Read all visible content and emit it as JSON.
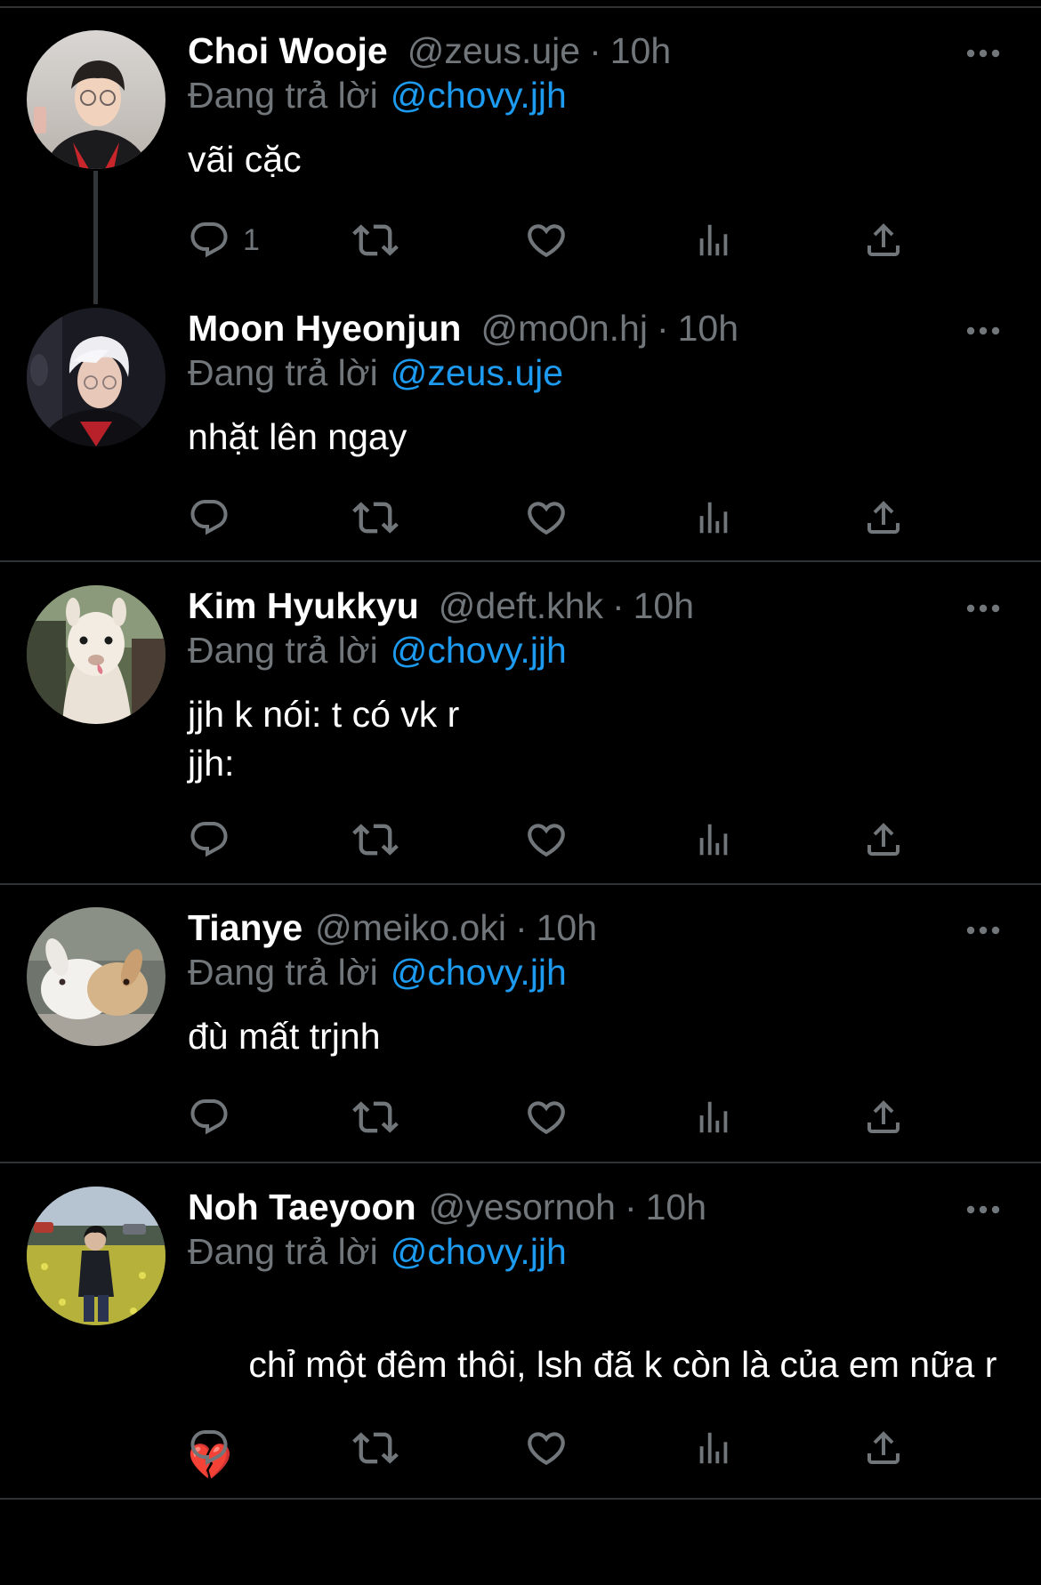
{
  "colors": {
    "background": "#000000",
    "name_text": "#ffffff",
    "muted_text": "#71767b",
    "mention": "#1d9bf0",
    "divider": "#2f3336",
    "icon": "#71767b"
  },
  "icons": {
    "more": "more-icon",
    "reply": "reply-icon",
    "retweet": "retweet-icon",
    "like": "heart-icon",
    "views": "views-icon",
    "share": "share-icon"
  },
  "tweets": [
    {
      "name": "Choi Wooje",
      "handle": "@zeus.uje",
      "dot": "·",
      "time": "10h",
      "reply_prefix": "Đang trả lời",
      "reply_to": "@chovy.jjh",
      "text": "vãi cặc",
      "reply_count": "1"
    },
    {
      "name": "Moon Hyeonjun",
      "handle": "@mo0n.hj",
      "dot": "·",
      "time": "10h",
      "reply_prefix": "Đang trả lời",
      "reply_to": "@zeus.uje",
      "text": "nhặt lên ngay",
      "reply_count": ""
    },
    {
      "name": "Kim Hyukkyu",
      "handle": "@deft.khk",
      "dot": "·",
      "time": "10h",
      "reply_prefix": "Đang trả lời",
      "reply_to": "@chovy.jjh",
      "text": "jjh k nói: t có vk r\njjh:",
      "reply_count": ""
    },
    {
      "name": " Tianye",
      "handle": "@meiko.oki",
      "dot": "·",
      "time": "10h",
      "reply_prefix": "Đang trả lời",
      "reply_to": "@chovy.jjh",
      "text": "đù mất trjnh",
      "reply_count": ""
    },
    {
      "name": "Noh Taeyoon",
      "handle": "@yesornoh",
      "dot": "·",
      "time": "10h",
      "reply_prefix": "Đang trả lời",
      "reply_to": "@chovy.jjh",
      "text": "chỉ một đêm thôi, lsh đã k còn là của em nữa r",
      "emoji": "💔",
      "reply_count": ""
    }
  ]
}
